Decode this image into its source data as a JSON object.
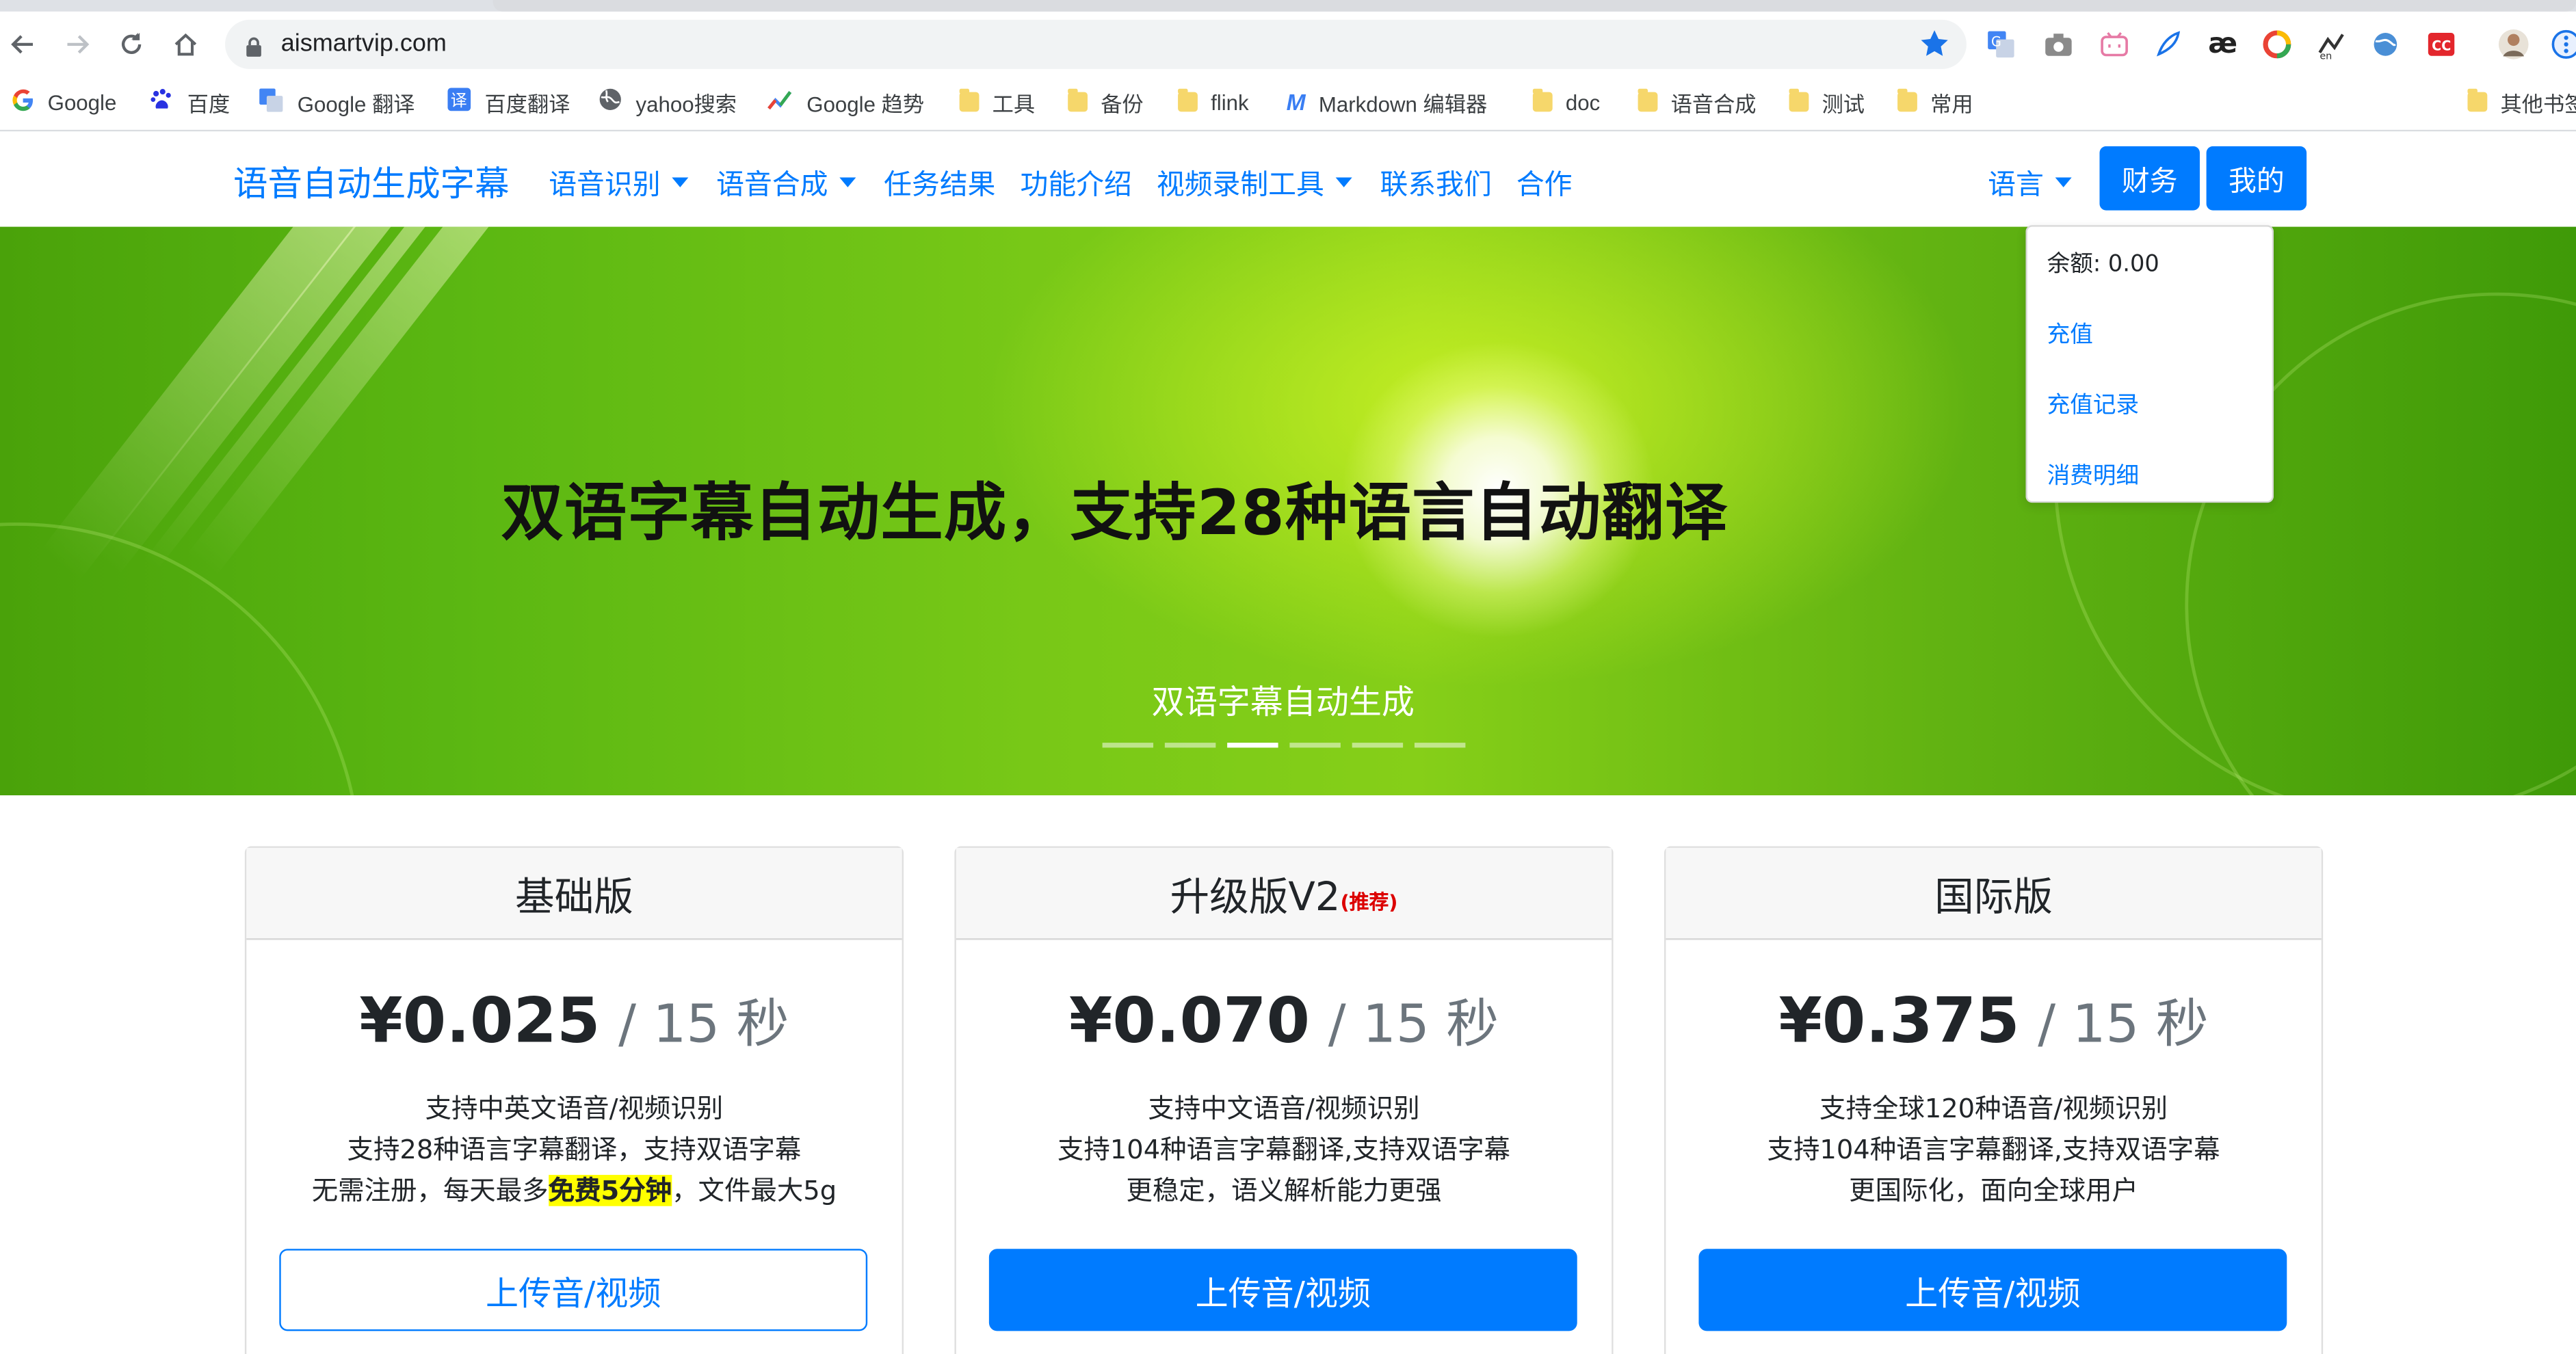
{
  "browser": {
    "url": "aismartvip.com",
    "bookmarks": [
      {
        "label": "Google",
        "icon": "google-icon"
      },
      {
        "label": "百度",
        "icon": "baidu-icon"
      },
      {
        "label": "Google 翻译",
        "icon": "translate-icon"
      },
      {
        "label": "百度翻译",
        "icon": "translate-icon"
      },
      {
        "label": "yahoo搜索",
        "icon": "globe-icon"
      },
      {
        "label": "Google 趋势",
        "icon": "trends-icon"
      },
      {
        "label": "工具",
        "icon": "folder-icon"
      },
      {
        "label": "备份",
        "icon": "folder-icon"
      },
      {
        "label": "flink",
        "icon": "folder-icon"
      },
      {
        "label": "Markdown 编辑器",
        "icon": "markdown-icon"
      },
      {
        "label": "doc",
        "icon": "folder-icon"
      },
      {
        "label": "语音合成",
        "icon": "folder-icon"
      },
      {
        "label": "测试",
        "icon": "folder-icon"
      },
      {
        "label": "常用",
        "icon": "folder-icon"
      },
      {
        "label": "其他书签",
        "icon": "folder-icon"
      }
    ]
  },
  "navbar": {
    "brand": "语音自动生成字幕",
    "items": [
      {
        "label": "语音识别",
        "dropdown": true
      },
      {
        "label": "语音合成",
        "dropdown": true
      },
      {
        "label": "任务结果",
        "dropdown": false
      },
      {
        "label": "功能介绍",
        "dropdown": false
      },
      {
        "label": "视频录制工具",
        "dropdown": true
      },
      {
        "label": "联系我们",
        "dropdown": false
      },
      {
        "label": "合作",
        "dropdown": false
      }
    ],
    "language": "语言",
    "finance": "财务",
    "mine": "我的"
  },
  "finance_menu": {
    "balance": "余额: 0.00",
    "recharge": "充值",
    "recharge_records": "充值记录",
    "consumption_details": "消费明细"
  },
  "hero": {
    "title": "双语字幕自动生成，支持28种语言自动翻译",
    "caption": "双语字幕自动生成",
    "slide_count": 6,
    "active_slide": 3
  },
  "plans": [
    {
      "name": "基础版",
      "badge": "",
      "price": "¥0.025",
      "unit": "/ 15 秒",
      "features": [
        "支持中英文语音/视频识别",
        "支持28种语言字幕翻译，支持双语字幕"
      ],
      "feature3_pre": "无需注册，每天最多",
      "feature3_highlight": "免费5分钟",
      "feature3_post": "，文件最大5g",
      "button": "上传音/视频"
    },
    {
      "name": "升级版V2",
      "badge": "(推荐)",
      "price": "¥0.070",
      "unit": "/ 15 秒",
      "features": [
        "支持中文语音/视频识别",
        "支持104种语言字幕翻译,支持双语字幕",
        "更稳定，语义解析能力更强"
      ],
      "button": "上传音/视频"
    },
    {
      "name": "国际版",
      "badge": "",
      "price": "¥0.375",
      "unit": "/ 15 秒",
      "features": [
        "支持全球120种语音/视频识别",
        "支持104种语言字幕翻译,支持双语字幕",
        "更国际化，面向全球用户"
      ],
      "button": "上传音/视频"
    }
  ],
  "colors": {
    "primary": "#007bff",
    "badge_red": "#dc0000",
    "highlight": "#ffff00",
    "hero_green": "#6cbf14"
  }
}
